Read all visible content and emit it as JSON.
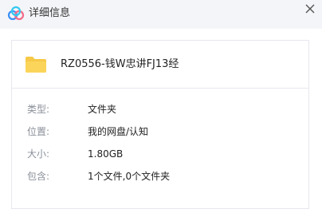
{
  "window": {
    "title": "详细信息",
    "logo_icon": "baidu-netdisk-cloud-icon",
    "close_icon": "close-icon"
  },
  "file": {
    "name": "RZ0556-钱W忠讲FJ13经",
    "icon": "folder-icon",
    "icon_color": "#f7c948"
  },
  "details": [
    {
      "label": "类型:",
      "value": "文件夹"
    },
    {
      "label": "位置:",
      "value": "我的网盘/认知"
    },
    {
      "label": "大小:",
      "value": "1.80GB"
    },
    {
      "label": "包含:",
      "value": "1个文件,0个文件夹"
    }
  ],
  "colors": {
    "titlebar_bg": "#f4f5f8",
    "label_text": "#8a8f99",
    "value_text": "#222222",
    "border": "#e6e8ee"
  }
}
